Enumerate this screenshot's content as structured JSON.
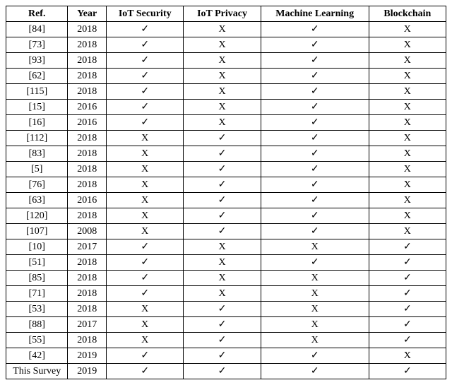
{
  "chart_data": {
    "type": "table",
    "title": "",
    "columns": [
      "Ref.",
      "Year",
      "IoT Security",
      "IoT Privacy",
      "Machine Learning",
      "Blockchain"
    ],
    "rows": [
      {
        "ref": "[84]",
        "year": "2018",
        "sec": true,
        "priv": false,
        "ml": true,
        "bc": false
      },
      {
        "ref": "[73]",
        "year": "2018",
        "sec": true,
        "priv": false,
        "ml": true,
        "bc": false
      },
      {
        "ref": "[93]",
        "year": "2018",
        "sec": true,
        "priv": false,
        "ml": true,
        "bc": false
      },
      {
        "ref": "[62]",
        "year": "2018",
        "sec": true,
        "priv": false,
        "ml": true,
        "bc": false
      },
      {
        "ref": "[115]",
        "year": "2018",
        "sec": true,
        "priv": false,
        "ml": true,
        "bc": false
      },
      {
        "ref": "[15]",
        "year": "2016",
        "sec": true,
        "priv": false,
        "ml": true,
        "bc": false
      },
      {
        "ref": "[16]",
        "year": "2016",
        "sec": true,
        "priv": false,
        "ml": true,
        "bc": false
      },
      {
        "ref": "[112]",
        "year": "2018",
        "sec": false,
        "priv": true,
        "ml": true,
        "bc": false
      },
      {
        "ref": "[83]",
        "year": "2018",
        "sec": false,
        "priv": true,
        "ml": true,
        "bc": false
      },
      {
        "ref": "[5]",
        "year": "2018",
        "sec": false,
        "priv": true,
        "ml": true,
        "bc": false
      },
      {
        "ref": "[76]",
        "year": "2018",
        "sec": false,
        "priv": true,
        "ml": true,
        "bc": false
      },
      {
        "ref": "[63]",
        "year": "2016",
        "sec": false,
        "priv": true,
        "ml": true,
        "bc": false
      },
      {
        "ref": "[120]",
        "year": "2018",
        "sec": false,
        "priv": true,
        "ml": true,
        "bc": false
      },
      {
        "ref": "[107]",
        "year": "2008",
        "sec": false,
        "priv": true,
        "ml": true,
        "bc": false
      },
      {
        "ref": "[10]",
        "year": "2017",
        "sec": true,
        "priv": false,
        "ml": false,
        "bc": true
      },
      {
        "ref": "[51]",
        "year": "2018",
        "sec": true,
        "priv": false,
        "ml": true,
        "bc": true
      },
      {
        "ref": "[85]",
        "year": "2018",
        "sec": true,
        "priv": false,
        "ml": false,
        "bc": true
      },
      {
        "ref": "[71]",
        "year": "2018",
        "sec": true,
        "priv": false,
        "ml": false,
        "bc": true
      },
      {
        "ref": "[53]",
        "year": "2018",
        "sec": false,
        "priv": true,
        "ml": false,
        "bc": true
      },
      {
        "ref": "[88]",
        "year": "2017",
        "sec": false,
        "priv": true,
        "ml": false,
        "bc": true
      },
      {
        "ref": "[55]",
        "year": "2018",
        "sec": false,
        "priv": true,
        "ml": false,
        "bc": true
      },
      {
        "ref": "[42]",
        "year": "2019",
        "sec": true,
        "priv": true,
        "ml": true,
        "bc": false
      },
      {
        "ref": "This Survey",
        "year": "2019",
        "sec": true,
        "priv": true,
        "ml": true,
        "bc": true
      }
    ]
  },
  "glyphs": {
    "yes": "✓",
    "no": "X"
  }
}
